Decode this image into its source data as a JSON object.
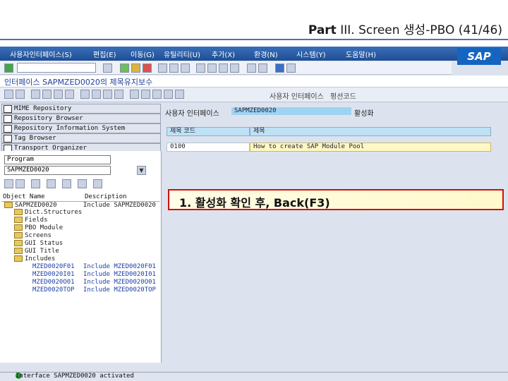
{
  "slide": {
    "title_prefix": "Part",
    "title_rest": "III. Screen 생성-PBO (41/46)"
  },
  "menu": {
    "items": [
      "사용자인터페이스(S)",
      "편집(E)",
      "이동(G)",
      "유틸리티(U)",
      "추가(X)",
      "환경(N)",
      "시스템(Y)",
      "도움말(H)"
    ],
    "logo": "SAP"
  },
  "title_bar": {
    "text": "인터페이스 SAPMZED0020의 제목유지보수"
  },
  "toolbar2": {
    "user_interface": "사용자 인터페이스",
    "function_code": "펑션코드"
  },
  "nav": [
    {
      "label": "MIME Repository"
    },
    {
      "label": "Repository Browser"
    },
    {
      "label": "Repository Information System"
    },
    {
      "label": "Tag Browser"
    },
    {
      "label": "Transport Organizer"
    }
  ],
  "left": {
    "type_select": "Program",
    "program_input": "SAPMZED0020",
    "col_object": "Object Name",
    "col_desc": "Description",
    "tree": [
      {
        "name": "SAPMZED0020",
        "desc": "Include SAPMZED0020"
      },
      {
        "name": "Dict.Structures",
        "desc": ""
      },
      {
        "name": "Fields",
        "desc": ""
      },
      {
        "name": "PBO Module",
        "desc": ""
      },
      {
        "name": "Screens",
        "desc": ""
      },
      {
        "name": "GUI Status",
        "desc": ""
      },
      {
        "name": "GUI Title",
        "desc": ""
      },
      {
        "name": "Includes",
        "desc": ""
      },
      {
        "name": "MZED0020F01",
        "desc": "Include MZED0020F01"
      },
      {
        "name": "MZED0020I01",
        "desc": "Include MZED0020I01"
      },
      {
        "name": "MZED0020O01",
        "desc": "Include MZED0020O01"
      },
      {
        "name": "MZED0020TOP",
        "desc": "Include MZED0020TOP"
      }
    ]
  },
  "right": {
    "interface_label": "사용자 인터페이스",
    "interface_value": "SAPMZED0020",
    "status": "활성화",
    "col_code": "제목 코드",
    "col_title": "제목",
    "row_code": "0100",
    "row_title": "How to create SAP Module Pool"
  },
  "callout": {
    "text": "1. 활성화 확인 후, Back(F3)"
  },
  "status_bar": {
    "text": "Interface SAPMZED0020 activated"
  },
  "colors": {
    "menubar": "#1e4e96",
    "callout_border": "#d10f0f",
    "title_text": "#1f3f99"
  }
}
